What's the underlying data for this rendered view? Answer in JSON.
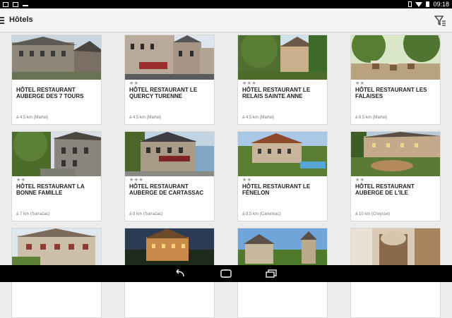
{
  "status_bar": {
    "time": "09:18"
  },
  "header": {
    "title": "Hôtels",
    "menu_icon": "hamburger-icon",
    "filter_icon": "filter-icon"
  },
  "hotels": [
    {
      "name": "HÔTEL RESTAURANT AUBERGE DES 7 TOURS",
      "stars": "",
      "distance": "à 4,5 km (Martel)"
    },
    {
      "name": "HÔTEL RESTAURANT LE QUERCY TURENNE",
      "stars": "★★",
      "distance": "à 4,5 km (Martel)"
    },
    {
      "name": "HÔTEL RESTAURANT LE RELAIS SAINTE ANNE",
      "stars": "★★★",
      "distance": "à 4,5 km (Martel)"
    },
    {
      "name": "HÔTEL RESTAURANT LES FALAISES",
      "stars": "★★",
      "distance": "à 6,5 km (Martel)"
    },
    {
      "name": "HÔTEL RESTAURANT LA BONNE FAMILLE",
      "stars": "★★",
      "distance": "à 7 km (Sarrazac)"
    },
    {
      "name": "HÔTEL RESTAURANT AUBERGE DE CARTASSAC",
      "stars": "★★★",
      "distance": "à 8 km (Sarrazac)"
    },
    {
      "name": "HÔTEL RESTAURANT LE FÉNELON",
      "stars": "★★",
      "distance": "à 8,5 km (Carennac)"
    },
    {
      "name": "HÔTEL RESTAURANT AUBERGE DE L'ILE",
      "stars": "★★",
      "distance": "à 10 km (Creysse)"
    },
    {
      "name": "",
      "stars": "",
      "distance": ""
    },
    {
      "name": "",
      "stars": "",
      "distance": ""
    },
    {
      "name": "",
      "stars": "",
      "distance": ""
    },
    {
      "name": "",
      "stars": "",
      "distance": ""
    }
  ],
  "nav": {
    "back_icon": "back-icon",
    "home_icon": "home-icon",
    "recents_icon": "recents-icon"
  }
}
